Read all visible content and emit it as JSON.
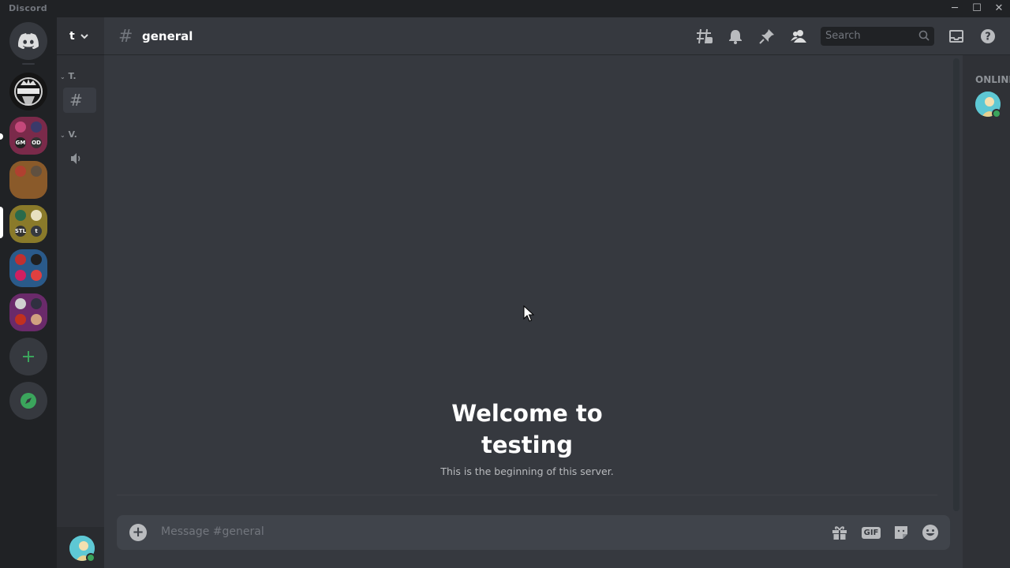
{
  "window": {
    "title": "Discord",
    "controls": [
      "─",
      "☐",
      "✕"
    ]
  },
  "server": {
    "initial": "t",
    "categories": [
      {
        "label": "T.",
        "channels": [
          {
            "type": "text",
            "name": ""
          }
        ]
      },
      {
        "label": "V.",
        "channels": [
          {
            "type": "voice",
            "name": ""
          }
        ]
      }
    ]
  },
  "channel": {
    "name": "general"
  },
  "search": {
    "placeholder": "Search"
  },
  "welcome": {
    "line1": "Welcome to",
    "line2": "testing",
    "subtitle": "This is the beginning of this server."
  },
  "composer": {
    "placeholder": "Message #general",
    "gif_label": "GIF"
  },
  "members": {
    "section_label": "ONLINE"
  },
  "guilds": {
    "folders": [
      {
        "tiles": [
          "",
          "",
          "GM",
          "OD"
        ]
      },
      {
        "tiles": [
          "",
          "",
          "",
          ""
        ]
      },
      {
        "tiles": [
          "",
          "",
          "STL",
          "t"
        ]
      },
      {
        "tiles": [
          "",
          "",
          "",
          ""
        ]
      },
      {
        "tiles": [
          "",
          "",
          "",
          ""
        ]
      }
    ]
  },
  "colors": {
    "accent_green": "#3ba55c",
    "background": "#36393f",
    "sidebar": "#2f3136",
    "rail": "#202225"
  }
}
